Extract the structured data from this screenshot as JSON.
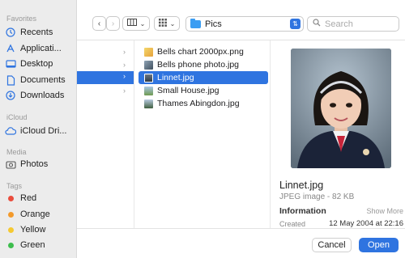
{
  "sidebar": {
    "favorites_title": "Favorites",
    "favorites": [
      {
        "label": "Recents",
        "icon": "clock-icon"
      },
      {
        "label": "Applicati...",
        "icon": "applications-icon"
      },
      {
        "label": "Desktop",
        "icon": "desktop-icon"
      },
      {
        "label": "Documents",
        "icon": "document-icon"
      },
      {
        "label": "Downloads",
        "icon": "download-icon"
      }
    ],
    "icloud_title": "iCloud",
    "icloud": [
      {
        "label": "iCloud Dri...",
        "icon": "cloud-icon"
      }
    ],
    "media_title": "Media",
    "media": [
      {
        "label": "Photos",
        "icon": "camera-icon"
      }
    ],
    "tags_title": "Tags",
    "tags": [
      {
        "label": "Red",
        "color": "#ea4d3d"
      },
      {
        "label": "Orange",
        "color": "#f39a2b"
      },
      {
        "label": "Yellow",
        "color": "#f5c931"
      },
      {
        "label": "Green",
        "color": "#3dbd4d"
      }
    ]
  },
  "toolbar": {
    "path_folder": "Pics",
    "search_placeholder": "Search"
  },
  "files": [
    {
      "name": "Bells chart 2000px.png",
      "icon": "chart-thumb-icon",
      "selected": false
    },
    {
      "name": "Bells phone photo.jpg",
      "icon": "photo-thumb-icon",
      "selected": false
    },
    {
      "name": "Linnet.jpg",
      "icon": "portrait-thumb-icon",
      "selected": true
    },
    {
      "name": "Small House.jpg",
      "icon": "house-thumb-icon",
      "selected": false
    },
    {
      "name": "Thames Abingdon.jpg",
      "icon": "landscape-thumb-icon",
      "selected": false
    }
  ],
  "preview": {
    "filename": "Linnet.jpg",
    "kind": "JPEG image - 82 KB",
    "info_label": "Information",
    "show_more": "Show More",
    "created_label": "Created",
    "created_value": "12 May 2004 at 22:16"
  },
  "footer": {
    "cancel": "Cancel",
    "open": "Open"
  },
  "colors": {
    "accent": "#2f74e0"
  }
}
